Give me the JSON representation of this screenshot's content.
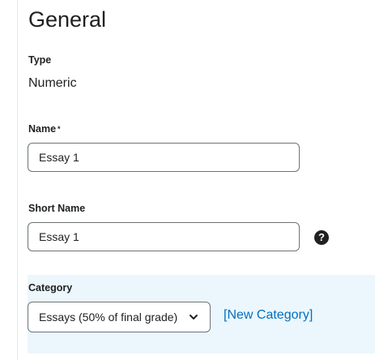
{
  "general": {
    "title": "General",
    "type": {
      "label": "Type",
      "value": "Numeric"
    },
    "name": {
      "label": "Name",
      "required_marker": "*",
      "value": "Essay 1"
    },
    "short_name": {
      "label": "Short Name",
      "value": "Essay 1",
      "help_glyph": "?"
    },
    "category": {
      "label": "Category",
      "selected": "Essays (50% of final grade)",
      "new_link": "[New Category]"
    }
  }
}
